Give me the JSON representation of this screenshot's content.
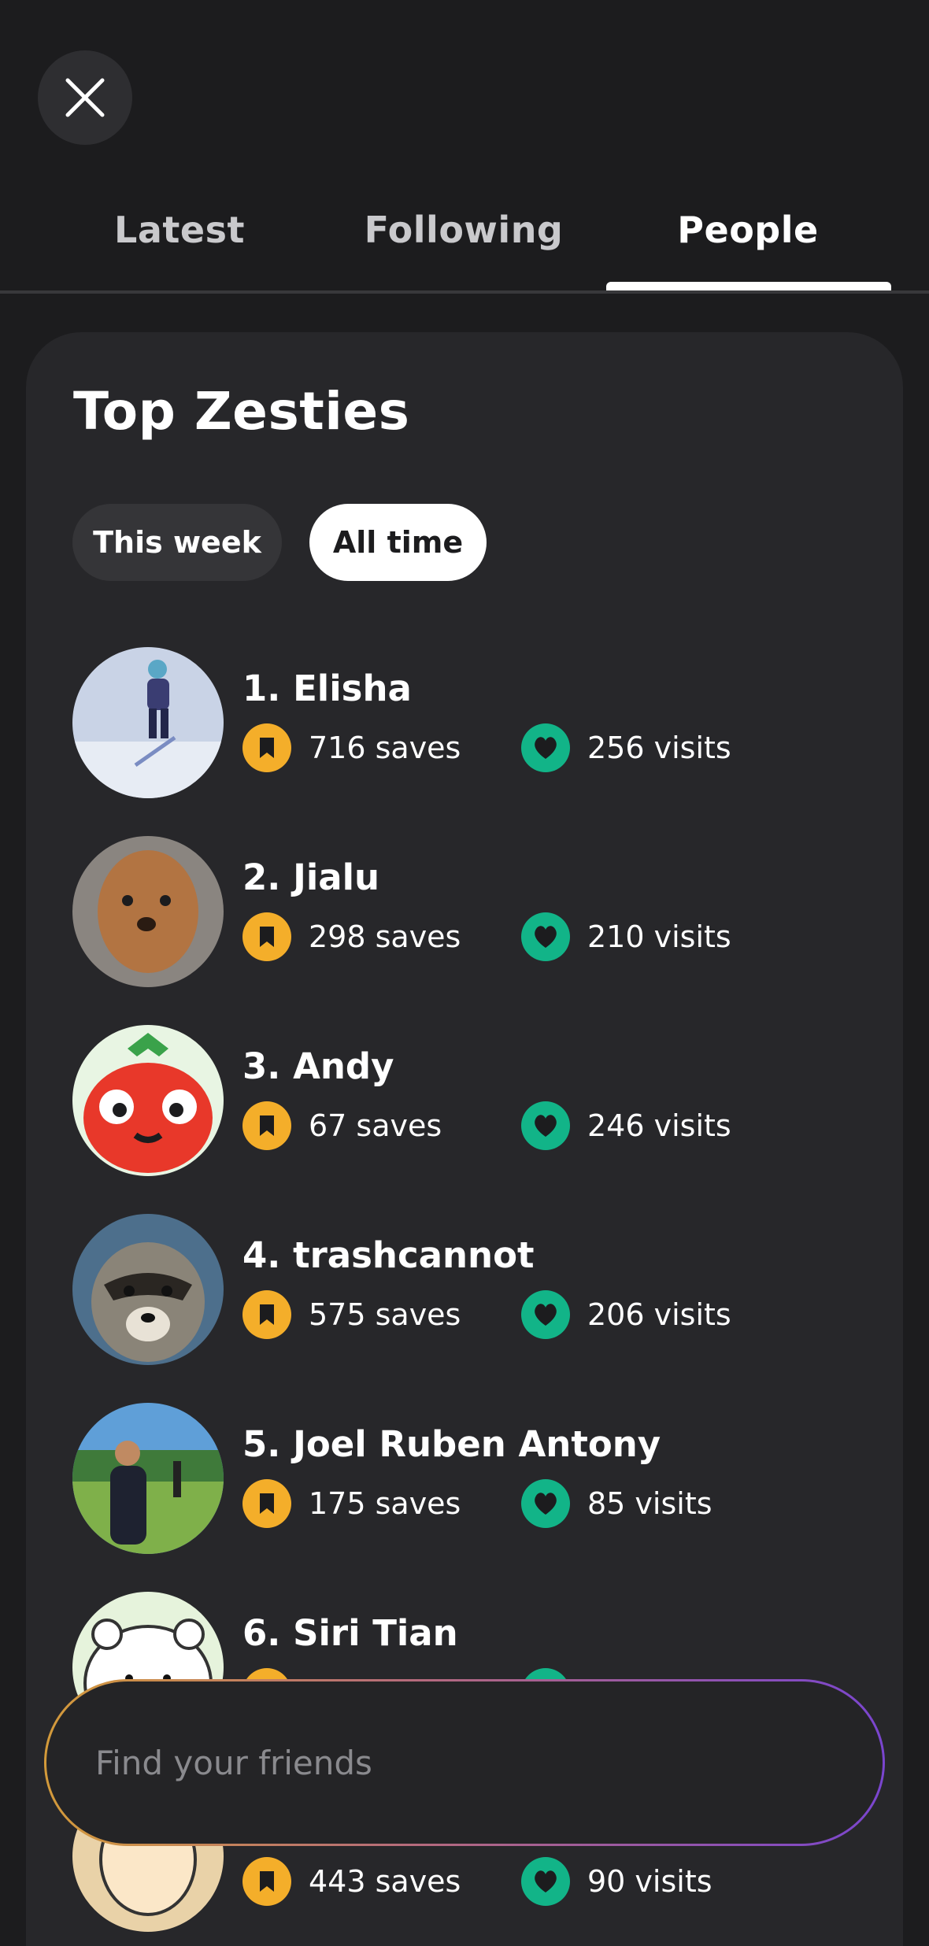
{
  "close_icon": "close-icon",
  "tabs": [
    {
      "label": "Latest",
      "active": false
    },
    {
      "label": "Following",
      "active": false
    },
    {
      "label": "People",
      "active": true
    }
  ],
  "card": {
    "title": "Top Zesties",
    "filters": {
      "this_week": "This week",
      "all_time": "All time",
      "selected": "All time"
    }
  },
  "colors": {
    "saves": "#f4ae2a",
    "visits": "#12b488",
    "background": "#1c1c1e",
    "card": "#27272a"
  },
  "people": [
    {
      "name": "1. Elisha",
      "saves": "716 saves",
      "visits": "256 visits",
      "avatar": "child skiing on snow"
    },
    {
      "name": "2. Jialu",
      "saves": "298 saves",
      "visits": "210 visits",
      "avatar": "brown poodle"
    },
    {
      "name": "3. Andy",
      "saves": "67 saves",
      "visits": "246 visits",
      "avatar": "strawberry cartoon"
    },
    {
      "name": "4. trashcannot",
      "saves": "575 saves",
      "visits": "206 visits",
      "avatar": "raccoon"
    },
    {
      "name": "5. Joel Ruben Antony",
      "saves": "175 saves",
      "visits": "85 visits",
      "avatar": "person in park"
    },
    {
      "name": "6. Siri Tian",
      "saves": "",
      "visits": "",
      "avatar": "cartoon bear"
    },
    {
      "name": "",
      "saves": "443 saves",
      "visits": "90 visits",
      "avatar": "cartoon person"
    }
  ],
  "search": {
    "placeholder": "Find your friends"
  }
}
